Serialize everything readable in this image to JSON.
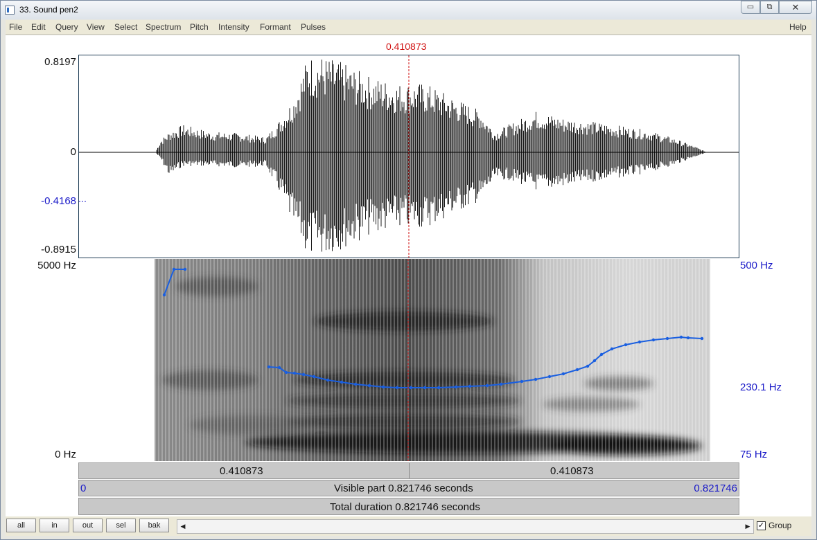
{
  "window": {
    "title": "33. Sound pen2",
    "min_glyph": "▭",
    "max_glyph": "⧉",
    "close_glyph": "✕"
  },
  "menu": {
    "items": [
      "File",
      "Edit",
      "Query",
      "View",
      "Select",
      "Spectrum",
      "Pitch",
      "Intensity",
      "Formant",
      "Pulses"
    ],
    "help": "Help"
  },
  "cursor": {
    "time_label": "0.410873",
    "time": 0.410873,
    "color": "#d01010"
  },
  "waveform": {
    "max_label": "0.8197",
    "zero_label": "0",
    "cursor_value_label": "-0.4168",
    "min_label": "-0.8915"
  },
  "spectrogram": {
    "top_label": "5000 Hz",
    "bottom_label": "0 Hz"
  },
  "pitch": {
    "top_label": "500 Hz",
    "cursor_label": "230.1 Hz",
    "bottom_label": "75 Hz",
    "color": "#1a5fe0"
  },
  "bars": {
    "left_segment": "0.410873",
    "right_segment": "0.410873",
    "visible_start": "0",
    "visible_label": "Visible part 0.821746 seconds",
    "visible_end": "0.821746",
    "total_label": "Total duration 0.821746 seconds"
  },
  "toolbar": {
    "all": "all",
    "in": "in",
    "out": "out",
    "sel": "sel",
    "bak": "bak",
    "scroll_left": "◀",
    "scroll_right": "▶",
    "group_label": "Group",
    "group_checked": "✓"
  }
}
